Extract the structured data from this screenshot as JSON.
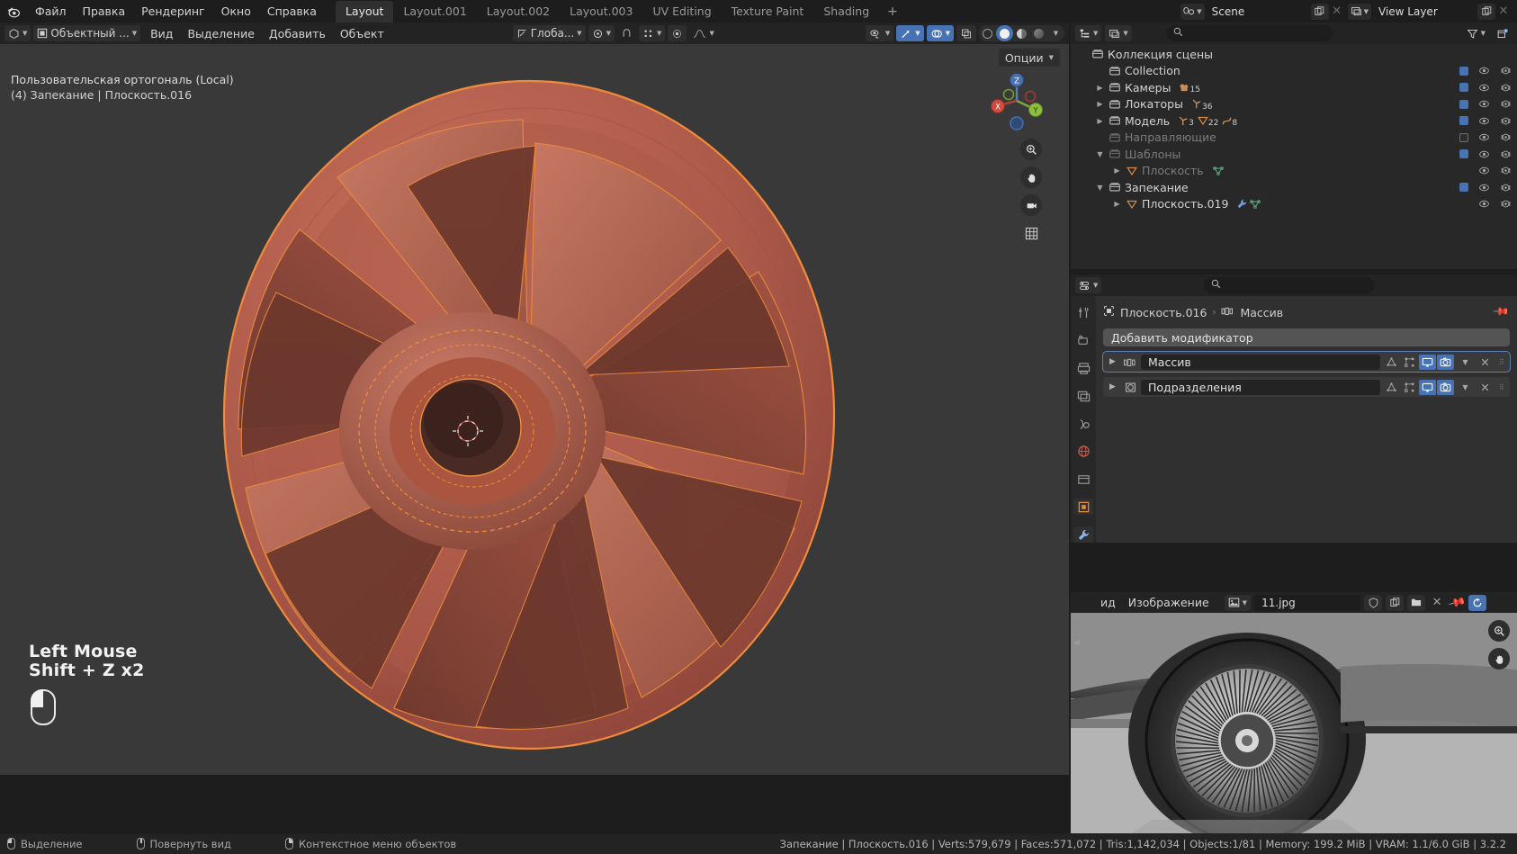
{
  "topbar": {
    "logo_icon": "blender-logo-icon",
    "menus": [
      "Файл",
      "Правка",
      "Рендеринг",
      "Окно",
      "Справка"
    ],
    "workspaces": [
      {
        "label": "Layout",
        "active": true
      },
      {
        "label": "Layout.001",
        "active": false
      },
      {
        "label": "Layout.002",
        "active": false
      },
      {
        "label": "Layout.003",
        "active": false
      },
      {
        "label": "UV Editing",
        "active": false
      },
      {
        "label": "Texture Paint",
        "active": false
      },
      {
        "label": "Shading",
        "active": false
      }
    ],
    "add_workspace": "+",
    "scene": {
      "icon": "scene-icon",
      "value": "Scene",
      "copy_icon": "new-scene-icon",
      "close_icon": "unlink-icon"
    },
    "view_layer": {
      "icon": "view-layer-icon",
      "value": "View Layer",
      "copy_icon": "new-layer-icon",
      "close_icon": "remove-layer-icon"
    }
  },
  "viewport_header": {
    "editor_type_icon": "editor-type-3dview-icon",
    "mode": "Объектный ...",
    "mode_icon": "object-mode-icon",
    "menus": [
      "Вид",
      "Выделение",
      "Добавить",
      "Объект"
    ],
    "transform_orientation": {
      "icon": "orientation-icon",
      "value": "Глоба..."
    },
    "snap_icon": "magnet-icon",
    "proportional_icon": "proportional-edit-icon",
    "proportional_falloff_icon": "falloff-curve-icon",
    "pivot_icon": "pivot-point-icon",
    "visibility_icon": "visibility-icon",
    "gizmo_icon": "gizmo-icon",
    "overlays_icon": "overlays-icon",
    "xray_icon": "xray-toggle-icon",
    "shading_modes": [
      "wireframe",
      "solid",
      "material-preview",
      "rendered"
    ],
    "shading_active": "solid",
    "shading_dropdown_icon": "chevron-down-icon"
  },
  "viewport": {
    "options_label": "Опции",
    "info_line1": "Пользовательская ортогональ (Local)",
    "info_line2": "(4) Запекание | Плоскость.016",
    "gizmo_axes": [
      "Z",
      "Y",
      "X"
    ],
    "nav_buttons": [
      "zoom-icon",
      "pan-hand-icon",
      "camera-view-icon",
      "orthographic-toggle-icon"
    ],
    "hint_line1": "Left Mouse",
    "hint_line2": "Shift + Z x2",
    "mouse_icon": "left-mouse-click-icon",
    "object_color": "#b5604f",
    "selection_outline_color": "#ef8b3a",
    "background_color": "#393939"
  },
  "outliner": {
    "header": {
      "display_mode_icon": "outliner-display-mode-icon",
      "filter_id_icon": "id-type-filter-icon",
      "search_placeholder": "",
      "search_icon": "search-icon",
      "filter_icon": "filter-funnel-icon",
      "new_collection_icon": "new-collection-icon"
    },
    "rows": [
      {
        "label": "Коллекция сцены",
        "indent": 0,
        "arrow": "",
        "icon": "collection-icon",
        "dim": false,
        "checkbox": null,
        "eye": false,
        "cam": false,
        "badges": []
      },
      {
        "label": "Collection",
        "indent": 1,
        "arrow": "",
        "icon": "collection-icon",
        "dim": false,
        "checkbox": true,
        "eye": true,
        "cam": true,
        "badges": []
      },
      {
        "label": "Камеры",
        "indent": 1,
        "arrow": "right",
        "icon": "collection-icon",
        "dim": false,
        "checkbox": true,
        "eye": true,
        "cam": true,
        "badges": [
          {
            "icon": "camera-data-icon",
            "count": "15"
          }
        ]
      },
      {
        "label": "Локаторы",
        "indent": 1,
        "arrow": "right",
        "icon": "collection-icon",
        "dim": false,
        "checkbox": true,
        "eye": true,
        "cam": true,
        "badges": [
          {
            "icon": "empty-axis-icon",
            "count": "36"
          }
        ]
      },
      {
        "label": "Модель",
        "indent": 1,
        "arrow": "right",
        "icon": "collection-icon",
        "dim": false,
        "checkbox": true,
        "eye": true,
        "cam": true,
        "badges": [
          {
            "icon": "empty-axis-icon",
            "count": "3"
          },
          {
            "icon": "mesh-data-icon",
            "count": "22"
          },
          {
            "icon": "curve-data-icon",
            "count": "8"
          }
        ]
      },
      {
        "label": "Направляющие",
        "indent": 1,
        "arrow": "",
        "icon": "collection-icon",
        "dim": true,
        "checkbox": false,
        "eye": true,
        "cam": true,
        "badges": []
      },
      {
        "label": "Шаблоны",
        "indent": 1,
        "arrow": "down",
        "icon": "collection-icon",
        "dim": true,
        "checkbox": true,
        "eye": true,
        "cam": true,
        "badges": []
      },
      {
        "label": "Плоскость",
        "indent": 2,
        "arrow": "right",
        "icon": "mesh-data-icon",
        "dim": true,
        "checkbox": null,
        "eye": true,
        "cam": true,
        "badges": [
          {
            "icon": "mesh-green-icon",
            "count": ""
          }
        ]
      },
      {
        "label": "Запекание",
        "indent": 1,
        "arrow": "down",
        "icon": "collection-icon",
        "dim": false,
        "checkbox": true,
        "eye": true,
        "cam": true,
        "badges": []
      },
      {
        "label": "Плоскость.019",
        "indent": 2,
        "arrow": "right",
        "icon": "mesh-data-icon",
        "dim": false,
        "checkbox": null,
        "eye": true,
        "cam": true,
        "badges": [
          {
            "icon": "modifier-blue-icon",
            "count": ""
          },
          {
            "icon": "mesh-green-icon",
            "count": ""
          }
        ]
      }
    ]
  },
  "properties": {
    "header": {
      "editor_icon": "properties-editor-icon",
      "search_icon": "search-icon",
      "search_placeholder": ""
    },
    "tabs": [
      {
        "name": "tool-tab",
        "icon": "tool-screwdriver-wrench-icon",
        "active": false
      },
      {
        "name": "render-tab",
        "icon": "render-camera-back-icon",
        "active": false
      },
      {
        "name": "output-tab",
        "icon": "output-printer-icon",
        "active": false
      },
      {
        "name": "view-layer-tab",
        "icon": "view-layer-images-icon",
        "active": false
      },
      {
        "name": "scene-tab",
        "icon": "scene-cone-icon",
        "active": false
      },
      {
        "name": "world-tab",
        "icon": "world-globe-icon",
        "active": false
      },
      {
        "name": "collection-tab",
        "icon": "collection-box-icon",
        "active": false
      },
      {
        "name": "object-tab",
        "icon": "object-orange-square-icon",
        "active": true
      },
      {
        "name": "modifier-tab",
        "icon": "modifier-wrench-icon",
        "active": true
      }
    ],
    "breadcrumb": {
      "object_icon": "object-square-icon",
      "object": "Плоскость.016",
      "sep": "›",
      "modifier_icon": "modifier-array-icon",
      "modifier": "Массив"
    },
    "pin_icon": "pin-icon",
    "add_modifier_label": "Добавить модификатор",
    "modifiers": [
      {
        "name": "Массив",
        "icon": "array-modifier-icon",
        "expanded": false,
        "selected": true,
        "toggles": [
          {
            "name": "show-on-cage",
            "icon": "edit-mode-cage-icon",
            "on": false
          },
          {
            "name": "show-in-editmode",
            "icon": "edit-mode-icon",
            "on": false
          },
          {
            "name": "show-in-viewport",
            "icon": "display-viewport-icon",
            "on": true
          },
          {
            "name": "show-in-render",
            "icon": "display-render-camera-icon",
            "on": true
          }
        ],
        "dropdown_icon": "chevron-down-icon",
        "close_icon": "x-icon",
        "grip_icon": "drag-grip-icon"
      },
      {
        "name": "Подразделения",
        "icon": "subdivision-modifier-icon",
        "expanded": false,
        "selected": false,
        "toggles": [
          {
            "name": "show-on-cage",
            "icon": "edit-mode-cage-icon",
            "on": false
          },
          {
            "name": "show-in-editmode",
            "icon": "edit-mode-icon",
            "on": false
          },
          {
            "name": "show-in-viewport",
            "icon": "display-viewport-icon",
            "on": true
          },
          {
            "name": "show-in-render",
            "icon": "display-render-camera-icon",
            "on": true
          }
        ],
        "dropdown_icon": "chevron-down-icon",
        "close_icon": "x-icon",
        "grip_icon": "drag-grip-icon"
      }
    ]
  },
  "image_editor": {
    "editor_icon": "image-editor-icon",
    "menus": [
      "ид",
      "Изображение"
    ],
    "browse_icon": "browse-image-icon",
    "image_name": "11.jpg",
    "fake_user_icon": "shield-fake-user-icon",
    "new_icon": "new-image-icon",
    "open_icon": "open-folder-icon",
    "unlink_icon": "x-icon",
    "pin_icon": "pin-icon",
    "refresh_icon": "refresh-icon",
    "side_buttons": [
      "zoom-icon",
      "pan-hand-icon"
    ],
    "content_description": "grayscale photo of a car wheel with multi-spoke alloy rim"
  },
  "statusbar": {
    "left_items": [
      {
        "icon": "mouse-left-icon",
        "label": "Выделение"
      },
      {
        "icon": "mouse-middle-icon",
        "label": "Повернуть вид"
      },
      {
        "icon": "mouse-right-icon",
        "label": "Контекстное меню объектов"
      }
    ],
    "scene_info": "Запекание | Плоскость.016 | Verts:579,679 | Faces:571,072 | Tris:1,142,034 | Objects:1/81 | Memory: 199.2 MiB | VRAM: 1.1/6.0 GiB | 3.2.2"
  }
}
